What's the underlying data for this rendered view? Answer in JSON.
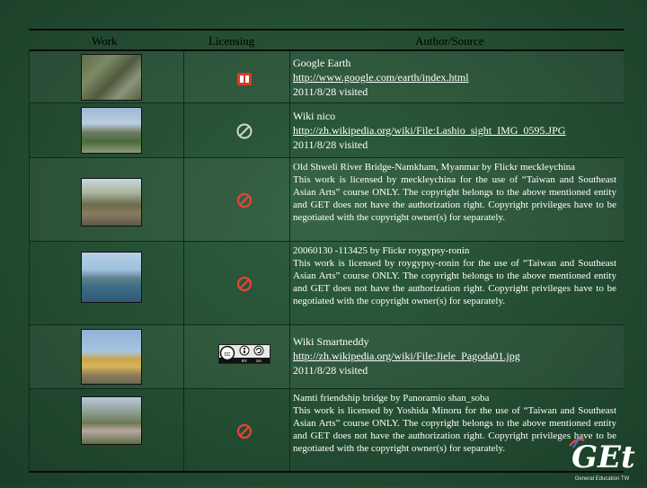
{
  "table": {
    "headers": {
      "work": "Work",
      "licensing": "Licensing",
      "source": "Author/Source"
    },
    "rows": [
      {
        "license_icon": "public-domain-icon",
        "lines": [
          "Google Earth",
          "http://www.google.com/earth/index.html",
          "2011/8/28 visited"
        ]
      },
      {
        "license_icon": "no-copyright-icon",
        "lines": [
          "Wiki  nico",
          "http://zh.wikipedia.org/wiki/File:Lashio_sight_IMG_0595.JPG",
          "2011/8/28 visited"
        ]
      },
      {
        "license_icon": "restricted-icon",
        "title": "Old Shweli River Bridge-Namkham, Myanmar by Flickr meckleychina",
        "body": "This work is licensed by meckleychina for the use of “Taiwan and Southeast Asian Arts” course ONLY. The copyright belongs to the above mentioned entity and GET does not have the authorization right. Copyright privileges have to be negotiated with the copyright owner(s) for separately."
      },
      {
        "license_icon": "restricted-icon",
        "title": "20060130 -113425 by Flickr roygypsy-ronin",
        "body": "This work is licensed by roygypsy-ronin for the use of “Taiwan and Southeast Asian Arts” course ONLY. The copyright belongs to the above mentioned entity and GET does not have the authorization right. Copyright privileges have to be negotiated with the copyright owner(s) for separately."
      },
      {
        "license_icon": "cc-by-sa-icon",
        "lines": [
          "Wiki  Smartneddy",
          "http://zh.wikipedia.org/wiki/File:Jiele_Pagoda01.jpg",
          "2011/8/28 visited"
        ]
      },
      {
        "license_icon": "restricted-icon",
        "title": "Namti friendship bridge by Panoramio shan_soba",
        "body": "This work is licensed by Yoshida Minoru for the use of “Taiwan and Southeast Asian Arts” course ONLY. The copyright belongs to the above mentioned entity and GET does not have the authorization right. Copyright privileges have to be negotiated with the copyright owner(s) for separately."
      }
    ]
  },
  "cc_badge": {
    "cc": "cc",
    "by": "BY",
    "sa": "SA"
  },
  "logo": {
    "text": "GEt",
    "tagline": "General Education TW"
  },
  "colors": {
    "background": "#244d32",
    "rule": "#0a0a0a",
    "restricted": "#e8433a",
    "public_domain": "#d93a2b"
  }
}
